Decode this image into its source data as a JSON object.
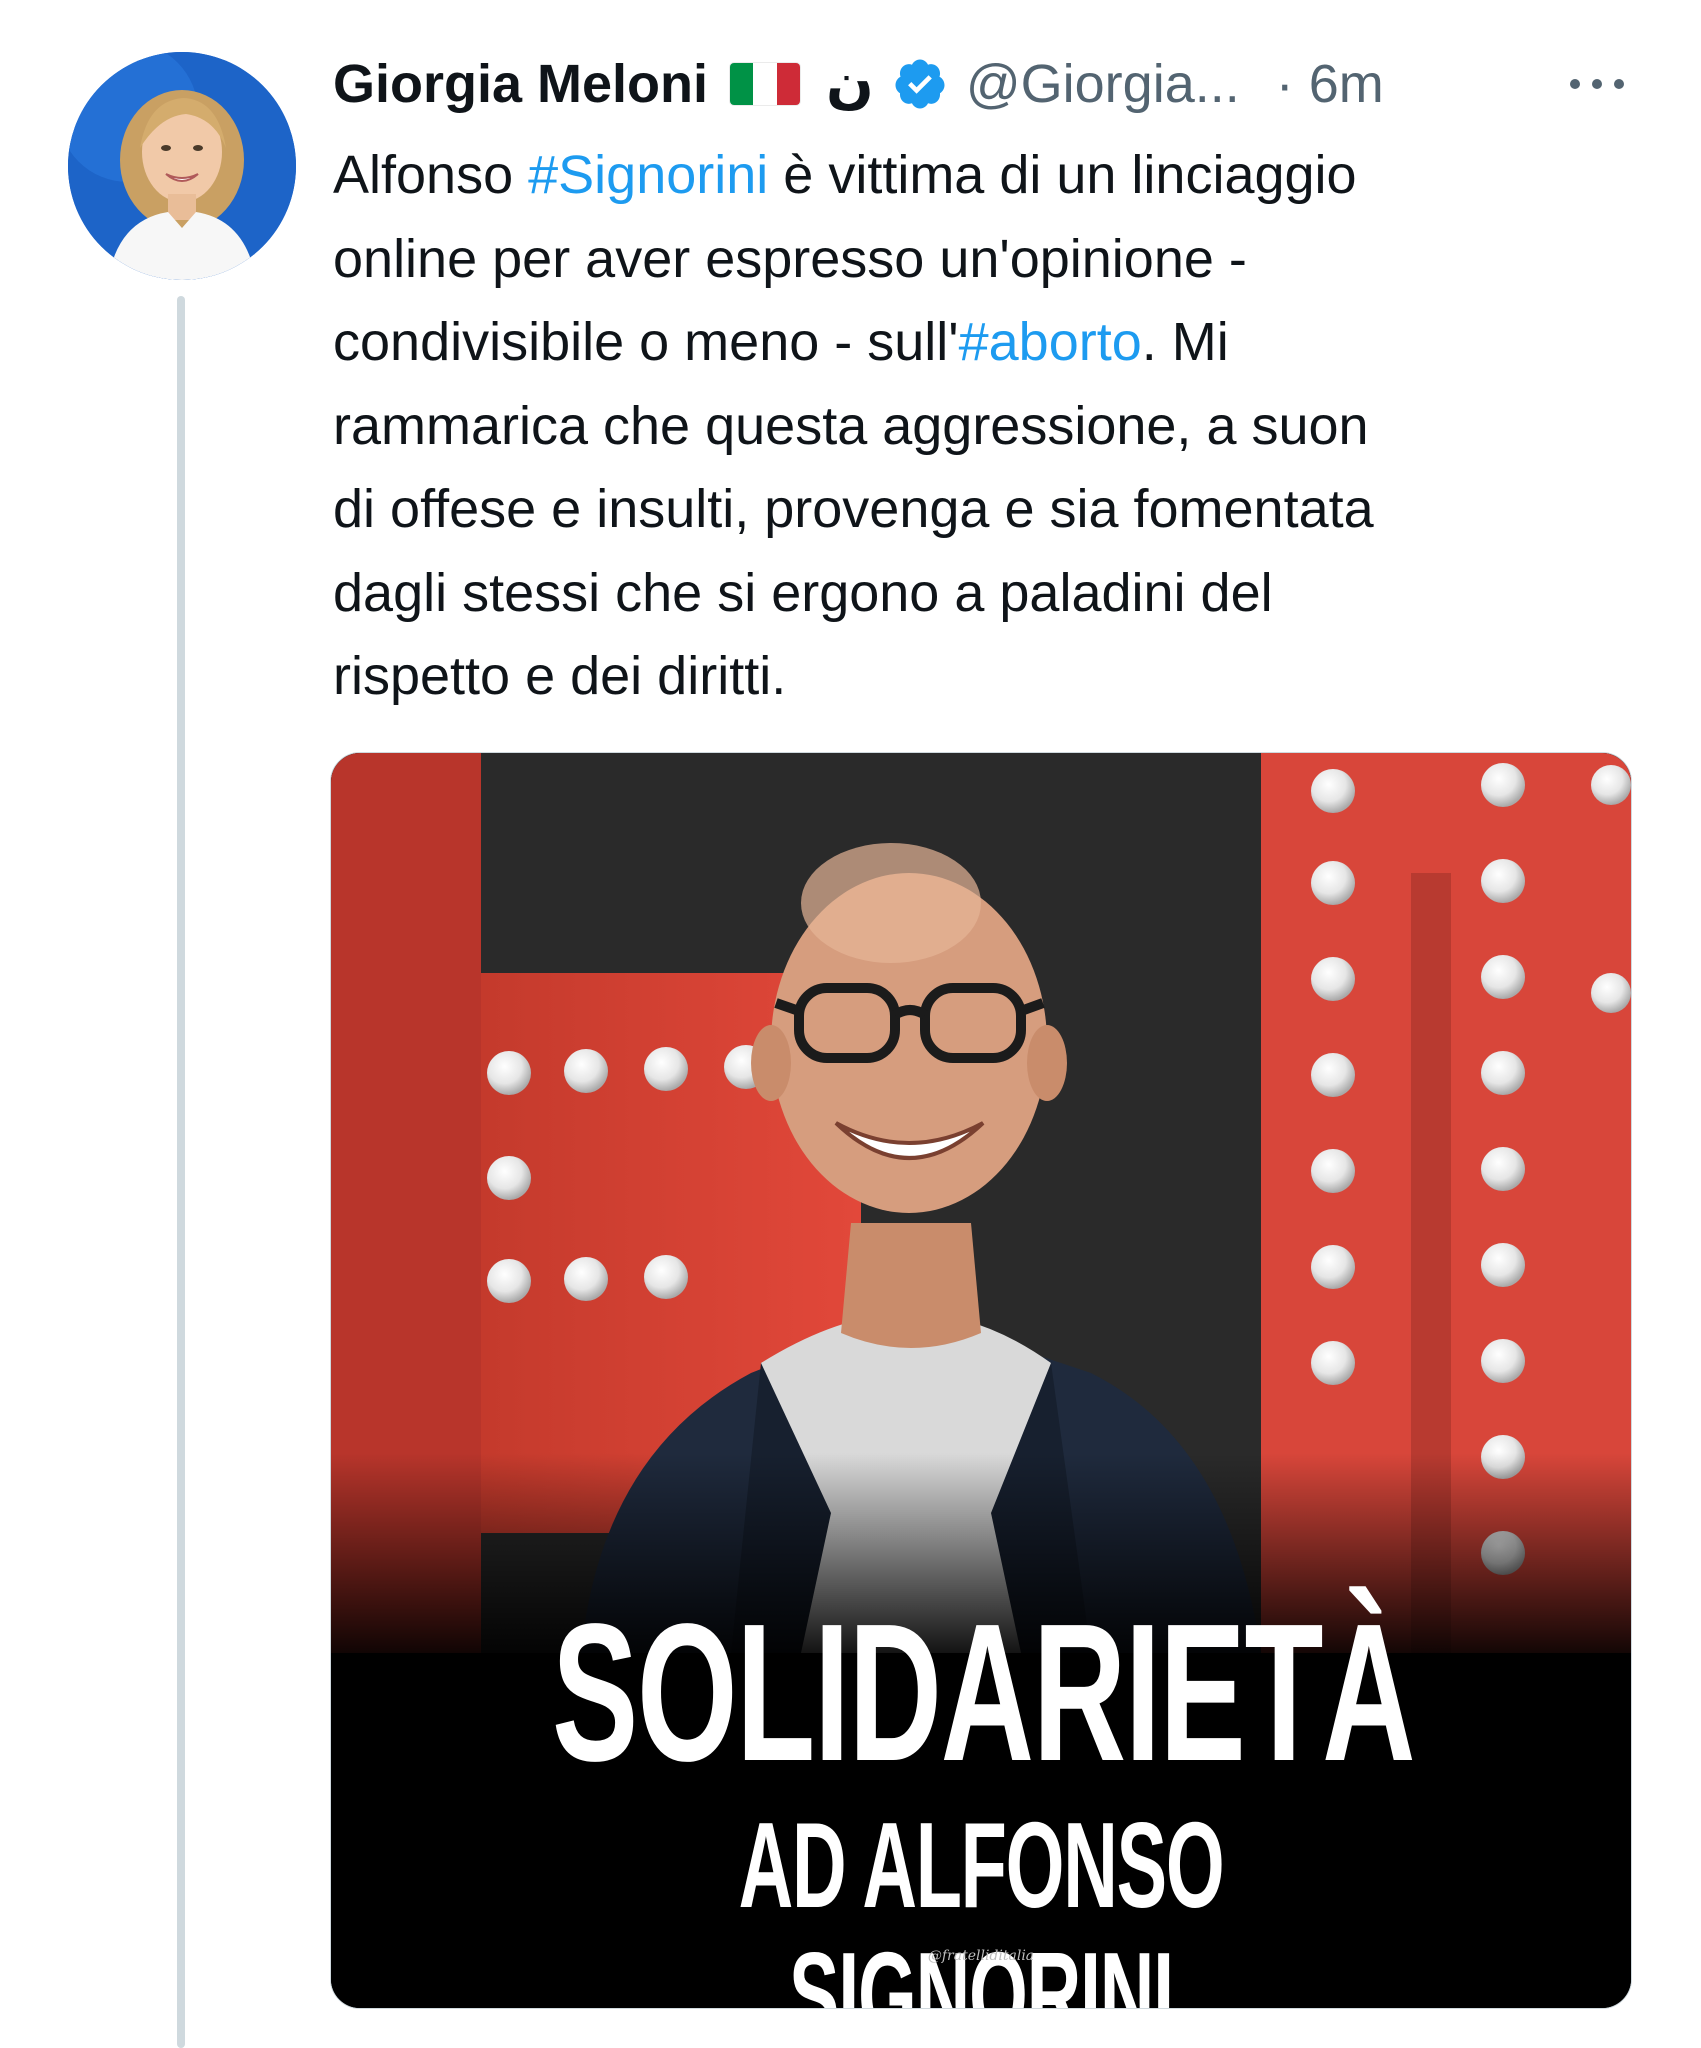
{
  "tweet": {
    "author_name": "Giorgia Meloni",
    "name_glyph": "ن",
    "handle": "@Giorgia...",
    "time": "· 6m",
    "text_lines": [
      [
        {
          "t": "Alfonso "
        },
        {
          "t": "#Signorini",
          "tag": true
        },
        {
          "t": " è vittima di un linciaggio"
        }
      ],
      [
        {
          "t": "online per aver espresso un'opinione -"
        }
      ],
      [
        {
          "t": "condivisibile o meno - sull'"
        },
        {
          "t": "#aborto",
          "tag": true
        },
        {
          "t": ". Mi"
        }
      ],
      [
        {
          "t": "rammarica che questa aggressione, a suon"
        }
      ],
      [
        {
          "t": "di offese e insulti, provenga e sia fomentata"
        }
      ],
      [
        {
          "t": "dagli stessi che si ergono a paladini del"
        }
      ],
      [
        {
          "t": "rispetto e dei diritti."
        }
      ]
    ]
  },
  "media": {
    "headline_1": "SOLIDARIETÀ",
    "headline_2": "AD ALFONSO SIGNORINI",
    "watermark": "@fratelliditalia"
  },
  "icons": {
    "avatar": "avatar",
    "flag": "italy-flag-icon",
    "verified": "verified-badge-icon",
    "more": "more-options-icon"
  },
  "colors": {
    "text": "#0f1419",
    "secondary": "#536471",
    "link": "#1d9bf0",
    "verified": "#1d9bf0",
    "thread_line": "#cfd9de",
    "flag_green": "#009246",
    "flag_white": "#ffffff",
    "flag_red": "#ce2b37"
  }
}
